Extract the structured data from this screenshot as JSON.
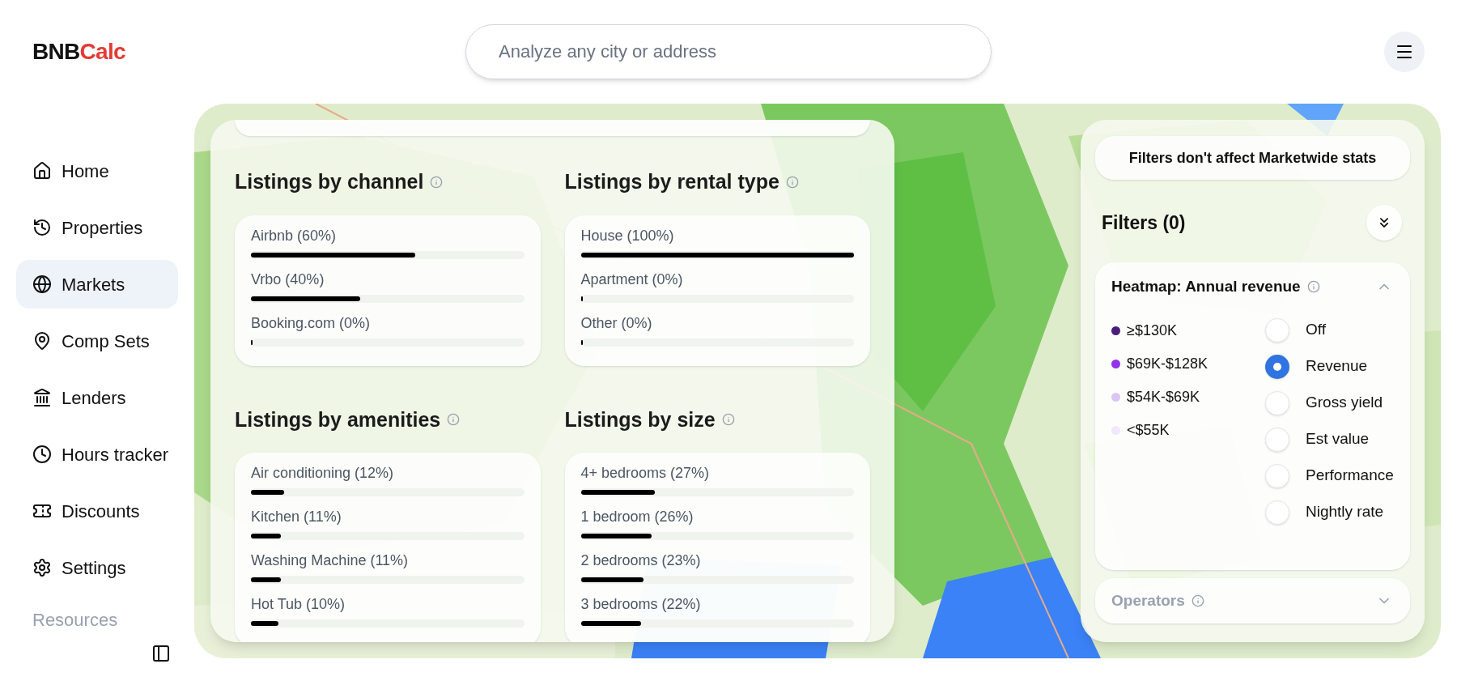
{
  "logo": {
    "part_1": "BNB",
    "part_2": "Calc"
  },
  "search": {
    "placeholder": "Analyze any city or address"
  },
  "sidebar": {
    "items": [
      {
        "label": "Home",
        "selected": false
      },
      {
        "label": "Properties",
        "selected": false
      },
      {
        "label": "Markets",
        "selected": true
      },
      {
        "label": "Comp Sets",
        "selected": false
      },
      {
        "label": "Lenders",
        "selected": false
      },
      {
        "label": "Hours tracker",
        "selected": false
      },
      {
        "label": "Discounts",
        "selected": false
      },
      {
        "label": "Settings",
        "selected": false
      }
    ],
    "section": {
      "label": "Resources"
    }
  },
  "stats": [
    {
      "title": "Listings by channel",
      "rows": [
        {
          "label": "Airbnb (60%)",
          "level": 0.6
        },
        {
          "label": "Vrbo (40%)",
          "level": 0.4
        },
        {
          "label": "Booking.com (0%)",
          "level": 0
        }
      ]
    },
    {
      "title": "Listings by rental type",
      "rows": [
        {
          "label": "House (100%)",
          "level": 1
        },
        {
          "label": "Apartment (0%)",
          "level": 0
        },
        {
          "label": "Other (0%)",
          "level": 0
        }
      ]
    },
    {
      "title": "Listings by amenities",
      "rows": [
        {
          "label": "Air conditioning (12%)",
          "level": 0.12
        },
        {
          "label": "Kitchen (11%)",
          "level": 0.11
        },
        {
          "label": "Washing Machine (11%)",
          "level": 0.11
        },
        {
          "label": "Hot Tub (10%)",
          "level": 0.1
        }
      ]
    },
    {
      "title": "Listings by size",
      "rows": [
        {
          "label": "4+ bedrooms (27%)",
          "level": 0.27
        },
        {
          "label": "1 bedroom (26%)",
          "level": 0.26
        },
        {
          "label": "2 bedrooms (23%)",
          "level": 0.23
        },
        {
          "label": "3 bedrooms (22%)",
          "level": 0.22
        }
      ]
    }
  ],
  "filters": {
    "notice": "Filters don't affect Marketwide stats",
    "title": "Filters (0)",
    "heatmap": {
      "title": "Heatmap: Annual revenue",
      "expanded": true,
      "legend": [
        {
          "label": "≥$130K",
          "color": "#4a1d7a"
        },
        {
          "label": "$69K-$128K",
          "color": "#9333ea"
        },
        {
          "label": "$54K-$69K",
          "color": "#dcc4f5"
        },
        {
          "label": "<$55K",
          "color": "#f1e8fb"
        }
      ],
      "options": [
        {
          "label": "Off",
          "selected": false
        },
        {
          "label": "Revenue",
          "selected": true
        },
        {
          "label": "Gross yield",
          "selected": false
        },
        {
          "label": "Est value",
          "selected": false
        },
        {
          "label": "Performance",
          "selected": false
        },
        {
          "label": "Nightly rate",
          "selected": false
        }
      ]
    },
    "operators": {
      "title": "Operators",
      "expanded": false
    }
  }
}
